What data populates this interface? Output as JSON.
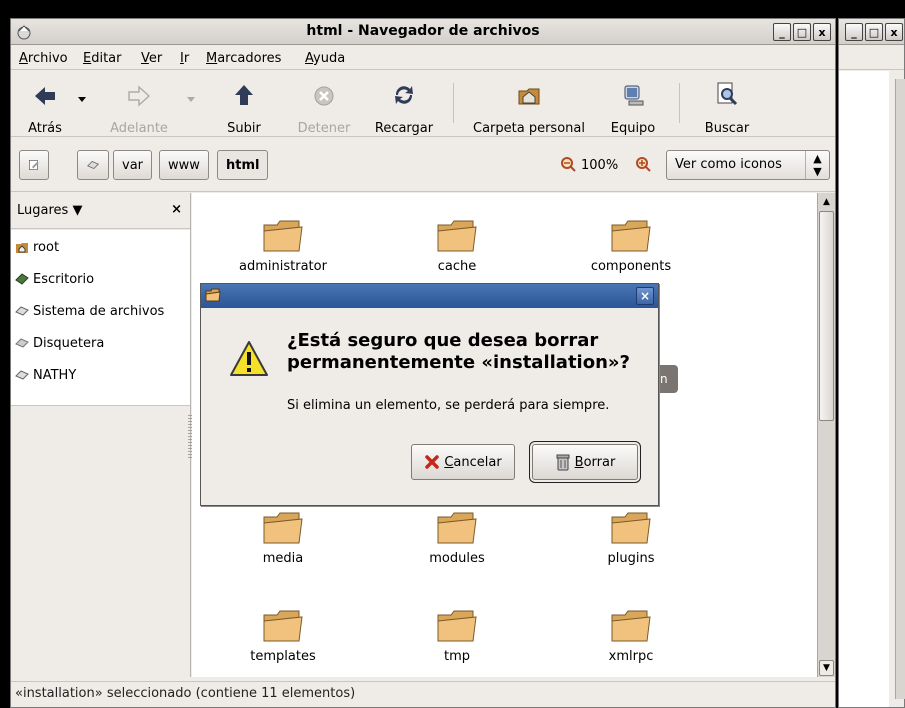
{
  "window": {
    "title": "html - Navegador de archivos",
    "buttons": [
      "_",
      "□",
      "x"
    ]
  },
  "menu": [
    "Archivo",
    "Editar",
    "Ver",
    "Ir",
    "Marcadores",
    "Ayuda"
  ],
  "toolbar": {
    "back": "Atrás",
    "forward": "Adelante",
    "up": "Subir",
    "stop": "Detener",
    "reload": "Recargar",
    "home": "Carpeta personal",
    "computer": "Equipo",
    "search": "Buscar"
  },
  "pathbar": {
    "segments": [
      "var",
      "www",
      "html"
    ],
    "zoom": "100%",
    "view_mode": "Ver como iconos"
  },
  "sidebar": {
    "header": "Lugares",
    "close": "×",
    "places": [
      "root",
      "Escritorio",
      "Sistema de archivos",
      "Disquetera",
      "NATHY"
    ]
  },
  "folders": {
    "row1": [
      "administrator",
      "cache",
      "components"
    ],
    "row3": [
      "media",
      "modules",
      "plugins"
    ],
    "row4": [
      "templates",
      "tmp",
      "xmlrpc"
    ],
    "partial": "n"
  },
  "status": "«installation» seleccionado (contiene 11 elementos)",
  "dialog": {
    "primary": "¿Está seguro que desea borrar permanentemente «installation»?",
    "secondary": "Si elimina un elemento, se perderá para siempre.",
    "cancel": "Cancelar",
    "delete": "Borrar"
  },
  "colors": {
    "dialog_title": "#3563a8",
    "folder_fill": "#f1c27d",
    "warning": "#f5e12a"
  }
}
